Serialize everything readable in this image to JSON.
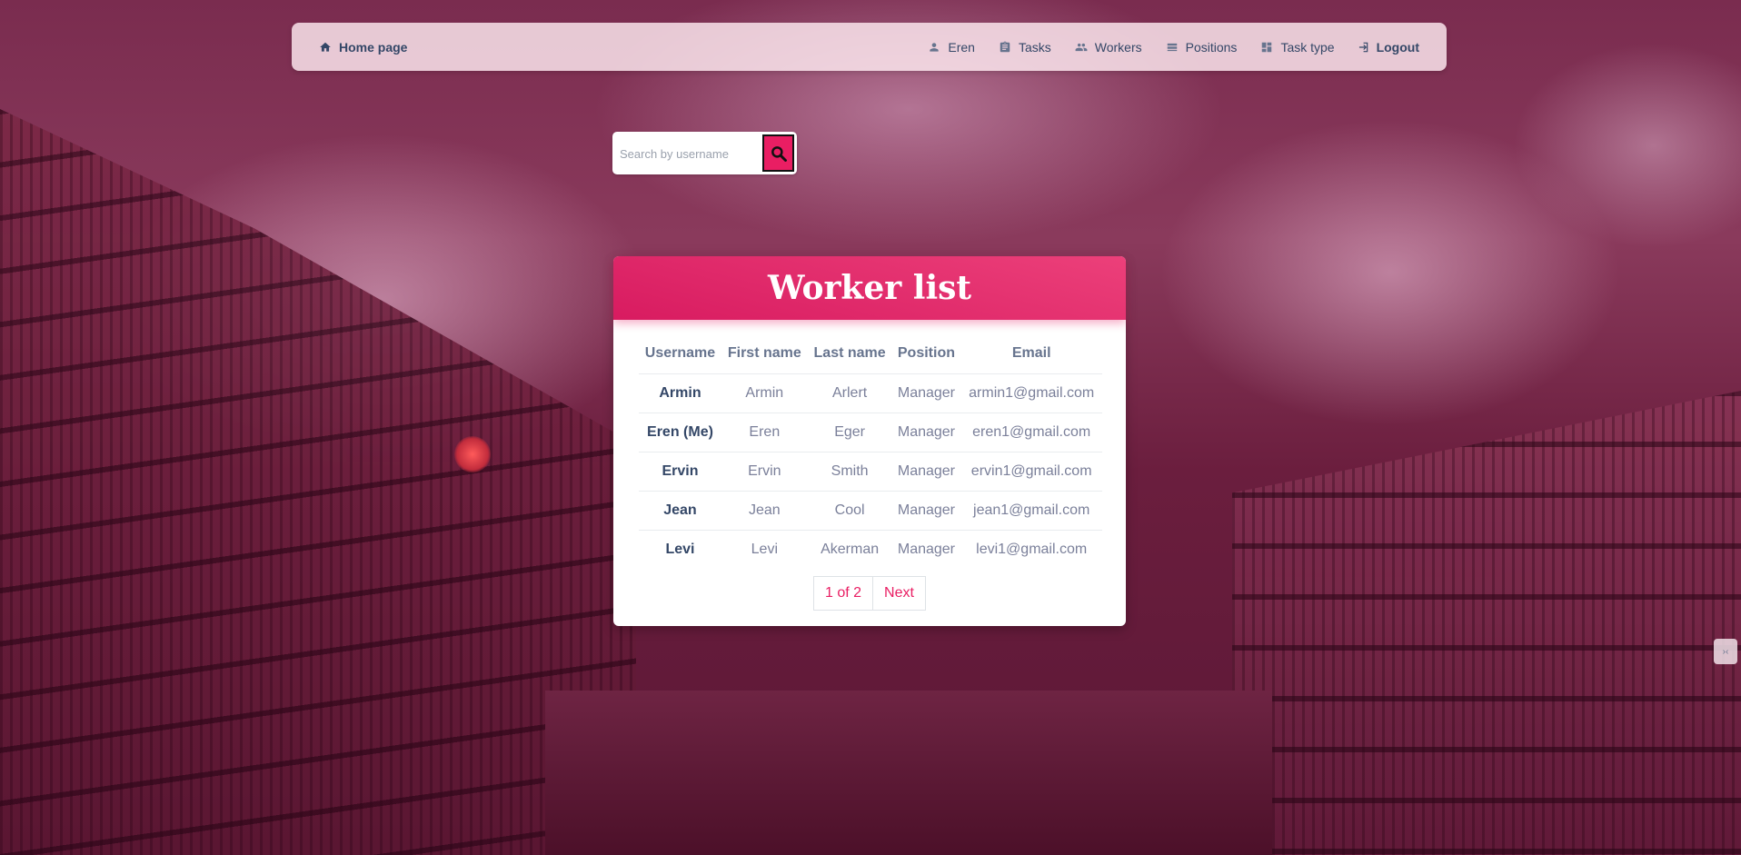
{
  "navbar": {
    "home_label": "Home page",
    "user_label": "Eren",
    "tasks_label": "Tasks",
    "workers_label": "Workers",
    "positions_label": "Positions",
    "task_type_label": "Task type",
    "logout_label": "Logout",
    "icons": [
      "home-icon",
      "person-icon",
      "clipboard-icon",
      "people-icon",
      "view-list-icon",
      "dashboard-icon",
      "logout-icon"
    ]
  },
  "search": {
    "placeholder": "Search by username",
    "button_icon": "search-icon"
  },
  "card": {
    "title": "Worker list"
  },
  "table": {
    "headers": [
      "Username",
      "First name",
      "Last name",
      "Position",
      "Email"
    ],
    "rows": [
      [
        "Armin",
        "Armin",
        "Arlert",
        "Manager",
        "armin1@gmail.com"
      ],
      [
        "Eren (Me)",
        "Eren",
        "Eger",
        "Manager",
        "eren1@gmail.com"
      ],
      [
        "Ervin",
        "Ervin",
        "Smith",
        "Manager",
        "ervin1@gmail.com"
      ],
      [
        "Jean",
        "Jean",
        "Cool",
        "Manager",
        "jean1@gmail.com"
      ],
      [
        "Levi",
        "Levi",
        "Akerman",
        "Manager",
        "levi1@gmail.com"
      ]
    ]
  },
  "pagination": {
    "current": "1 of 2",
    "next_label": "Next"
  },
  "colors": {
    "accent": "#e91e63",
    "text_dark": "#344767",
    "text_muted": "#7b809a"
  }
}
